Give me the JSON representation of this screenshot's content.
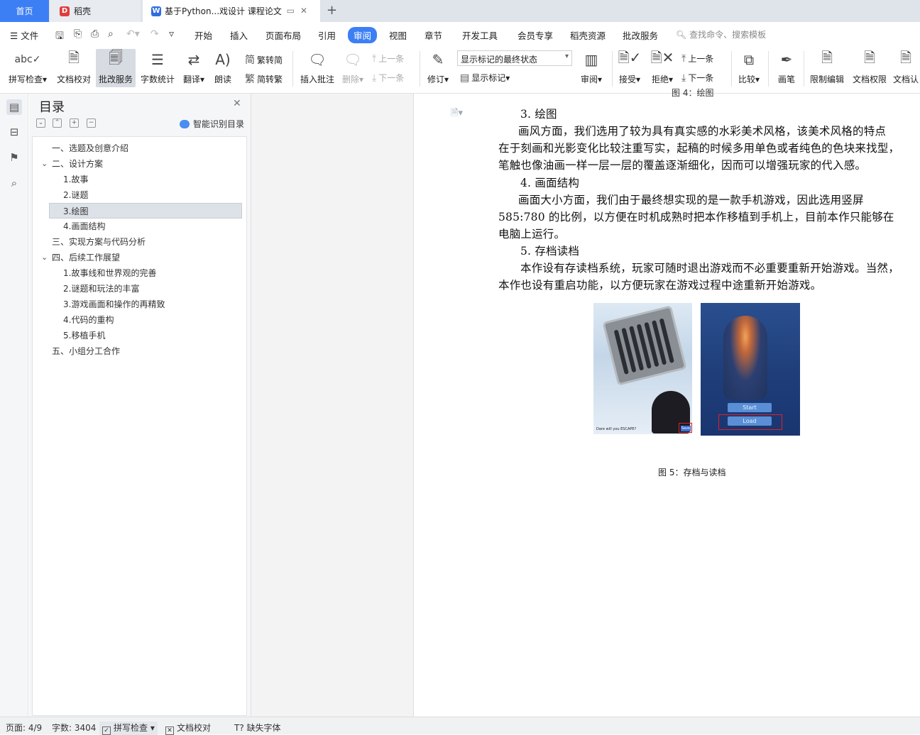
{
  "tabs": {
    "home": "首页",
    "daoke": "稻壳",
    "doc": "基于Python...戏设计 课程论文"
  },
  "menu": {
    "file": "文件",
    "items": [
      "开始",
      "插入",
      "页面布局",
      "引用",
      "审阅",
      "视图",
      "章节",
      "开发工具",
      "会员专享",
      "稻壳资源",
      "批改服务"
    ],
    "search_placeholder": "查找命令、搜索模板"
  },
  "ribbon": {
    "spell_check": "拼写检查",
    "doc_proof": "文档校对",
    "correction_service": "批改服务",
    "word_count": "字数统计",
    "translate": "翻译",
    "read_aloud": "朗读",
    "trad_to_simp": "繁转简",
    "simp_to_trad": "简转繁",
    "insert_comment": "插入批注",
    "delete": "删除",
    "prev": "上一条",
    "next": "下一条",
    "revise": "修订",
    "markup_state": "显示标记的最终状态",
    "show_markup": "显示标记",
    "review": "审阅",
    "accept": "接受",
    "reject": "拒绝",
    "prev2": "上一条",
    "next2": "下一条",
    "compare": "比较",
    "pen": "画笔",
    "restrict_edit": "限制编辑",
    "doc_permission": "文档权限",
    "doc_cert": "文档认"
  },
  "nav": {
    "title": "目录",
    "smart_toc": "智能识别目录",
    "items": [
      "一、选题及创意介绍",
      "二、设计方案",
      "1.故事",
      "2.谜题",
      "3.绘图",
      "4.画面结构",
      "三、实现方案与代码分析",
      "四、后续工作展望",
      "1.故事线和世界观的完善",
      "2.谜题和玩法的丰富",
      "3.游戏画面和操作的再精致",
      "4.代码的重构",
      "5.移植手机",
      "五、小组分工合作"
    ]
  },
  "doc": {
    "top_caption": "图 4：绘图",
    "lines": [
      "3.  绘图",
      "画风方面，我们选用了较为具有真实感的水彩美术风格，该美术风格的特点",
      "在于刻画和光影变化比较注重写实，起稿的时候多用单色或者纯色的色块来找型，",
      "笔触也像油画一样一层一层的覆盖逐渐细化，因而可以增强玩家的代入感。",
      "4.  画面结构",
      "画面大小方面，我们由于最终想实现的是一款手机游戏，因此选用竖屏",
      "585:780 的比例，以方便在时机成熟时把本作移植到手机上，目前本作只能够在",
      "电脑上运行。",
      "5.  存档读档",
      "本作设有存读档系统，玩家可随时退出游戏而不必重要重新开始游戏。当然，",
      "本作也设有重启功能，以方便玩家在游戏过程中途重新开始游戏。"
    ],
    "fig_left_text": "Dare will you ESCAPE?",
    "fig_left_button": "Save",
    "fig_right_start": "Start",
    "fig_right_load": "Load",
    "figure_caption": "图 5：存档与读档"
  },
  "status": {
    "page": "页面: 4/9",
    "words": "字数: 3404",
    "spell": "拼写检查",
    "proof": "文档校对",
    "missing_font": "缺失字体"
  }
}
